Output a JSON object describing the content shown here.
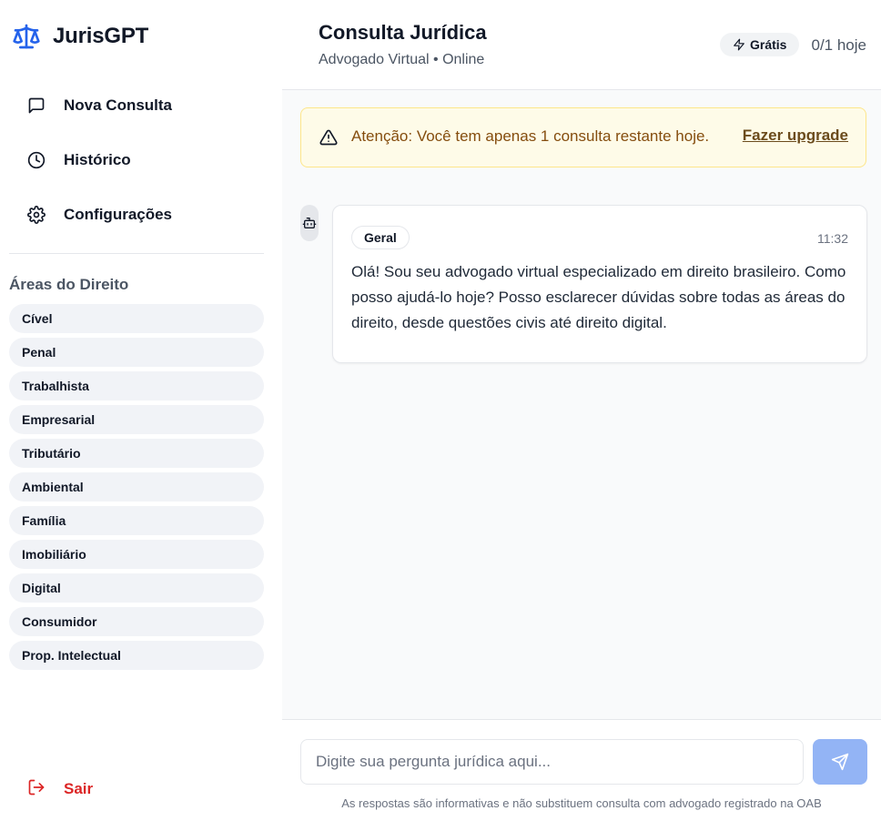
{
  "brand": {
    "name": "JurisGPT",
    "accent": "#2563eb"
  },
  "nav": {
    "items": [
      {
        "label": "Nova Consulta",
        "icon": "message-square-icon"
      },
      {
        "label": "Histórico",
        "icon": "clock-icon"
      },
      {
        "label": "Configurações",
        "icon": "gear-icon"
      }
    ]
  },
  "areas": {
    "title": "Áreas do Direito",
    "items": [
      "Cível",
      "Penal",
      "Trabalhista",
      "Empresarial",
      "Tributário",
      "Ambiental",
      "Família",
      "Imobiliário",
      "Digital",
      "Consumidor",
      "Prop. Intelectual"
    ]
  },
  "logout": {
    "label": "Sair",
    "color": "#dc2626"
  },
  "header": {
    "title": "Consulta Jurídica",
    "subtitle": "Advogado Virtual • Online",
    "plan": "Grátis",
    "usage": "0/1 hoje"
  },
  "warning": {
    "message": "Atenção: Você tem apenas 1 consulta restante hoje.",
    "action": "Fazer upgrade"
  },
  "messages": [
    {
      "sender": "bot",
      "tag": "Geral",
      "time": "11:32",
      "text": "Olá! Sou seu advogado virtual especializado em direito brasileiro. Como posso ajudá-lo hoje? Posso esclarecer dúvidas sobre todas as áreas do direito, desde questões civis até direito digital."
    }
  ],
  "composer": {
    "placeholder": "Digite sua pergunta jurídica aqui...",
    "disclaimer": "As respostas são informativas e não substituem consulta com advogado registrado na OAB"
  }
}
